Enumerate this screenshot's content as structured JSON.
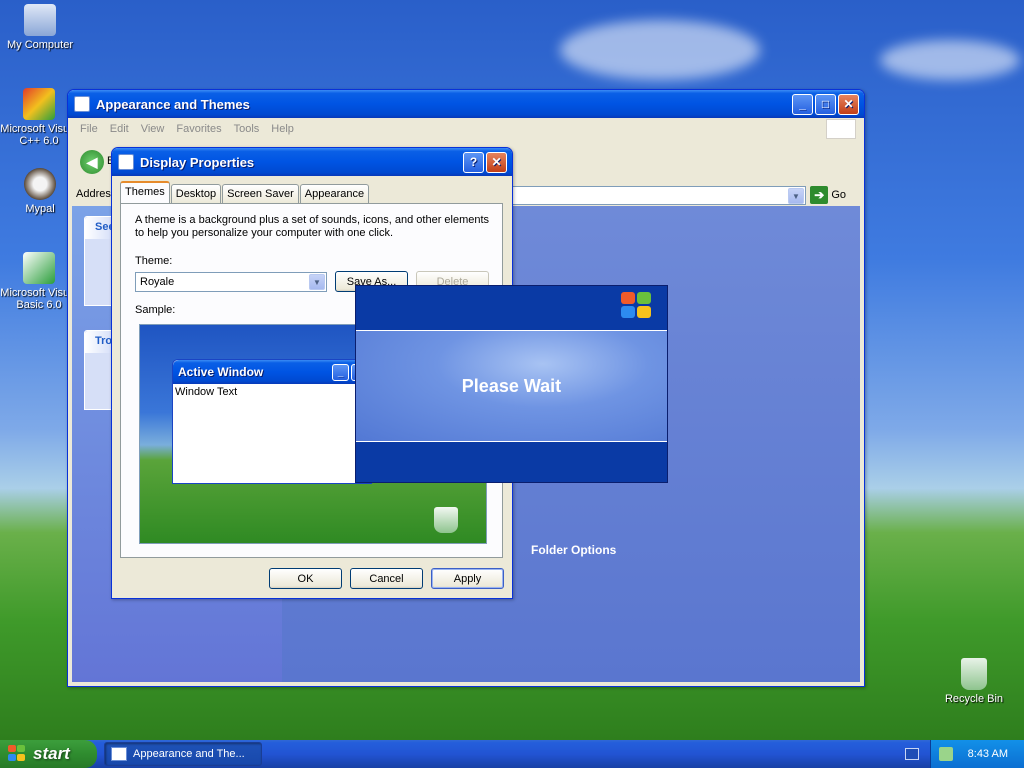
{
  "desktop": {
    "icons": [
      {
        "label": "My Computer"
      },
      {
        "label": "Microsoft Visual C++ 6.0"
      },
      {
        "label": "Mypal"
      },
      {
        "label": "Microsoft Visual Basic 6.0"
      },
      {
        "label": "Recycle Bin"
      }
    ]
  },
  "appearance_window": {
    "title": "Appearance and Themes",
    "menu": [
      "File",
      "Edit",
      "View",
      "Favorites",
      "Tools",
      "Help"
    ],
    "back_label": "B",
    "address_label": "Address",
    "go_label": "Go",
    "panel_1_title": "See",
    "panel_2_title": "Tro",
    "folder_options": "Folder Options"
  },
  "display_properties": {
    "title": "Display Properties",
    "help_glyph": "?",
    "close_glyph": "✕",
    "tabs": [
      "Themes",
      "Desktop",
      "Screen Saver",
      "Appearance"
    ],
    "description": "A theme is a background plus a set of sounds, icons, and other elements to help you personalize your computer with one click.",
    "theme_label": "Theme:",
    "theme_value": "Royale",
    "save_as": "Save As...",
    "delete": "Delete",
    "sample_label": "Sample:",
    "sample_window_title": "Active Window",
    "sample_window_text": "Window Text",
    "ok": "OK",
    "cancel": "Cancel",
    "apply": "Apply"
  },
  "splash": {
    "message": "Please Wait"
  },
  "taskbar": {
    "start": "start",
    "task_item": "Appearance and The...",
    "clock": "8:43 AM"
  },
  "colors": {
    "xp_blue": "#0054e3",
    "start_green": "#2f8c2f",
    "tray_blue": "#0c6fd2"
  }
}
